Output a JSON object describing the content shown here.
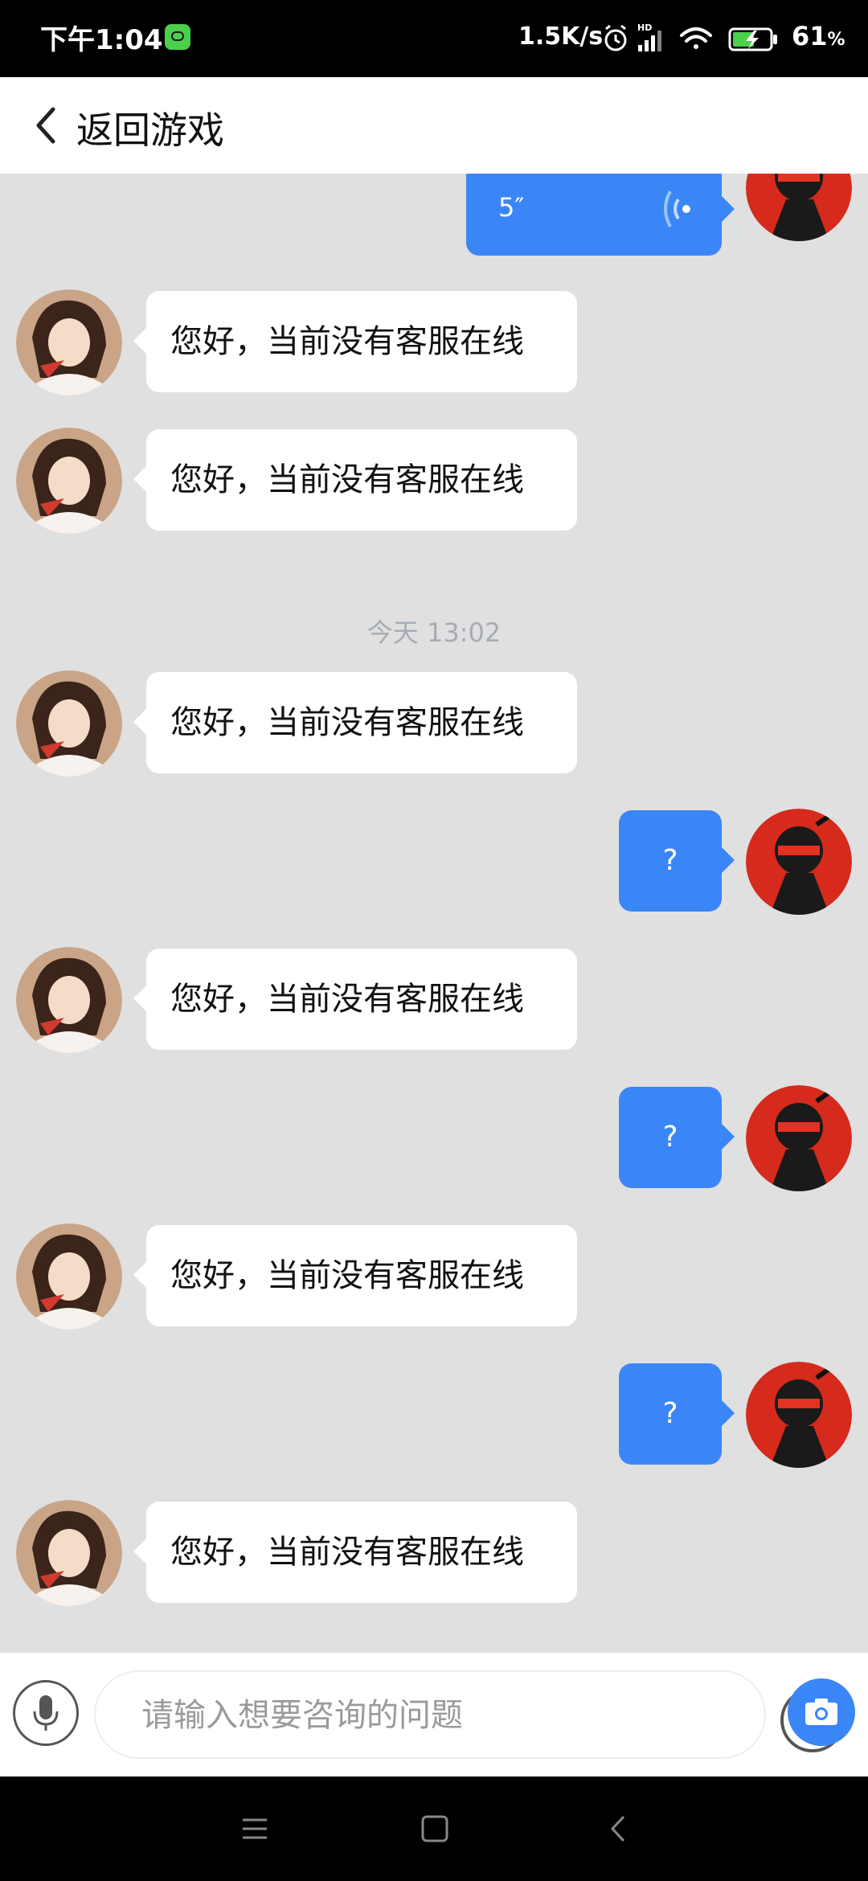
{
  "status_bar": {
    "time": "下午1:04",
    "net_speed": "1.5K/s",
    "battery_percent": "61",
    "battery_unit": "%",
    "icons": [
      "app-notification-icon",
      "alarm-icon",
      "hd-signal-icon",
      "wifi-icon",
      "battery-charging-icon"
    ]
  },
  "header": {
    "back_label": "返回游戏"
  },
  "chat": {
    "voice_message": {
      "duration": "5″",
      "sender": "me"
    },
    "timestamp": "今天 13:02",
    "support_reply": "您好，当前没有客服在线",
    "user_question": "?",
    "messages": [
      {
        "sender": "me",
        "type": "voice",
        "text": "5″"
      },
      {
        "sender": "support",
        "type": "text",
        "text": "您好，当前没有客服在线"
      },
      {
        "sender": "support",
        "type": "text",
        "text": "您好，当前没有客服在线"
      },
      {
        "type": "timestamp",
        "text": "今天 13:02"
      },
      {
        "sender": "support",
        "type": "text",
        "text": "您好，当前没有客服在线"
      },
      {
        "sender": "me",
        "type": "text",
        "text": "?"
      },
      {
        "sender": "support",
        "type": "text",
        "text": "您好，当前没有客服在线"
      },
      {
        "sender": "me",
        "type": "text",
        "text": "?"
      },
      {
        "sender": "support",
        "type": "text",
        "text": "您好，当前没有客服在线"
      },
      {
        "sender": "me",
        "type": "text",
        "text": "?"
      },
      {
        "sender": "support",
        "type": "text",
        "text": "您好，当前没有客服在线"
      }
    ]
  },
  "input_bar": {
    "placeholder": "请输入想要咨询的问题",
    "value": ""
  },
  "colors": {
    "accent": "#3b86f7",
    "chat_background": "#e0e0e0",
    "timestamp": "#a6acb4"
  }
}
